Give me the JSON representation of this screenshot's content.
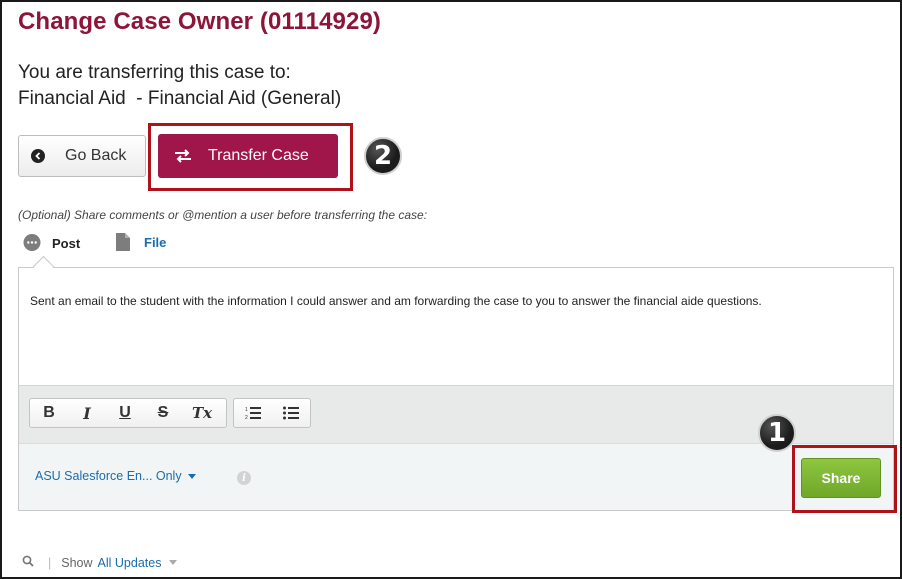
{
  "page": {
    "title": "Change Case Owner (01114929)",
    "transfer_intro": "You are transferring this case to:",
    "transfer_target": "Financial Aid  - Financial Aid (General)"
  },
  "actions": {
    "go_back_label": "Go Back",
    "transfer_label": "Transfer Case"
  },
  "annotations": {
    "step_1": "1",
    "step_2": "2",
    "highlight_color": "#b0121b"
  },
  "composer": {
    "optional_text": "(Optional) Share comments or @mention a user before transferring the case:",
    "tabs": [
      {
        "label": "Post",
        "icon": "speech-bubble-icon"
      },
      {
        "label": "File",
        "icon": "document-icon"
      }
    ],
    "message": "Sent an email to the student with the information I could answer and am forwarding the case to you to answer the financial aide questions.",
    "toolbar": {
      "bold": "B",
      "italic": "I",
      "underline": "U",
      "strike": "S",
      "clear_format": "Tx"
    },
    "visibility_label": "ASU Salesforce En... Only",
    "share_label": "Share"
  },
  "feed": {
    "show_label": "Show",
    "filter_label": "All Updates"
  },
  "colors": {
    "brand": "#8c1538",
    "transfer_button": "#a0154a",
    "share_button": "#7cb834",
    "link": "#1a6dac"
  }
}
